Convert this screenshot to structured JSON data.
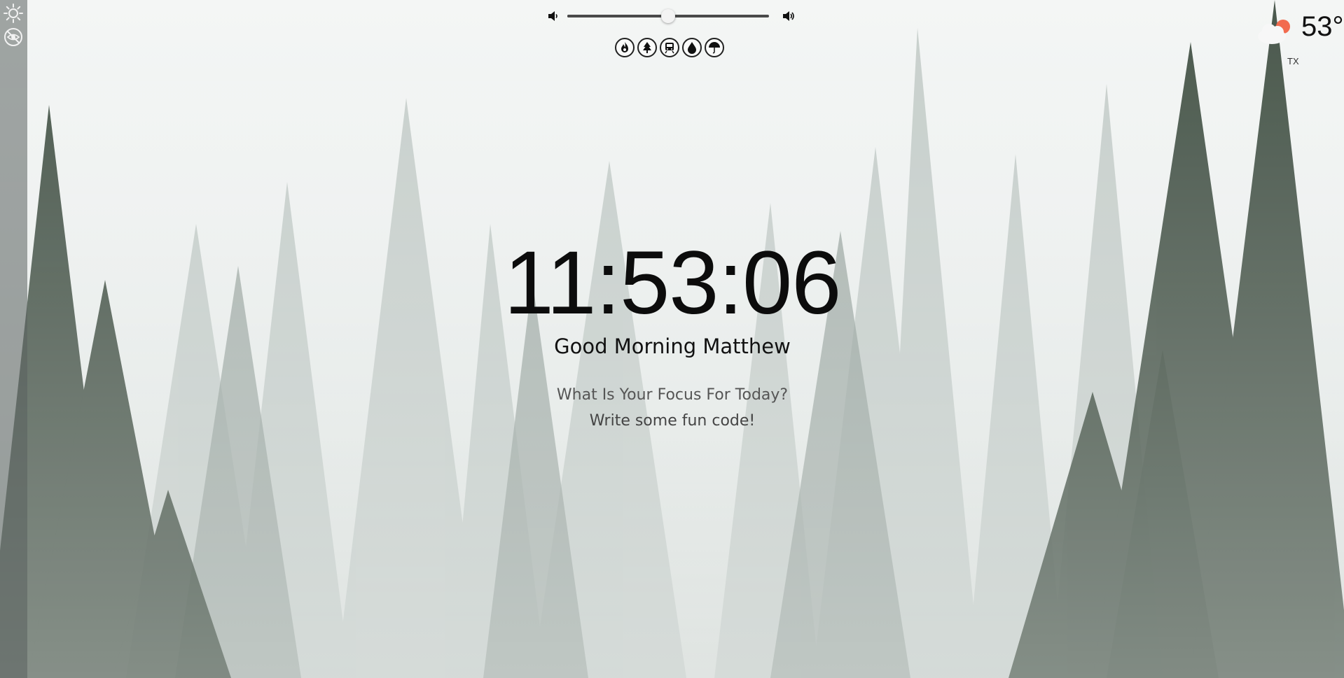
{
  "sidebar": {
    "items": [
      {
        "icon": "brightness-icon"
      },
      {
        "icon": "eye-off-icon"
      }
    ]
  },
  "audio": {
    "volume_percent": 50,
    "mute_icon": "volume-low-icon",
    "max_icon": "volume-high-icon"
  },
  "sounds": [
    {
      "icon": "fire-icon"
    },
    {
      "icon": "tree-icon"
    },
    {
      "icon": "train-icon"
    },
    {
      "icon": "water-drop-icon"
    },
    {
      "icon": "umbrella-icon"
    }
  ],
  "weather": {
    "icon": "partly-cloudy-icon",
    "temperature": "53°",
    "location": "TX"
  },
  "main": {
    "time": "11:53:06",
    "greeting": "Good Morning Matthew",
    "focus_question": "What Is Your Focus For Today?",
    "focus_answer": "Write some fun code!"
  },
  "colors": {
    "text_dark": "#0c0c0c",
    "text_muted": "#555555",
    "sun_orange": "#f26b4f"
  }
}
